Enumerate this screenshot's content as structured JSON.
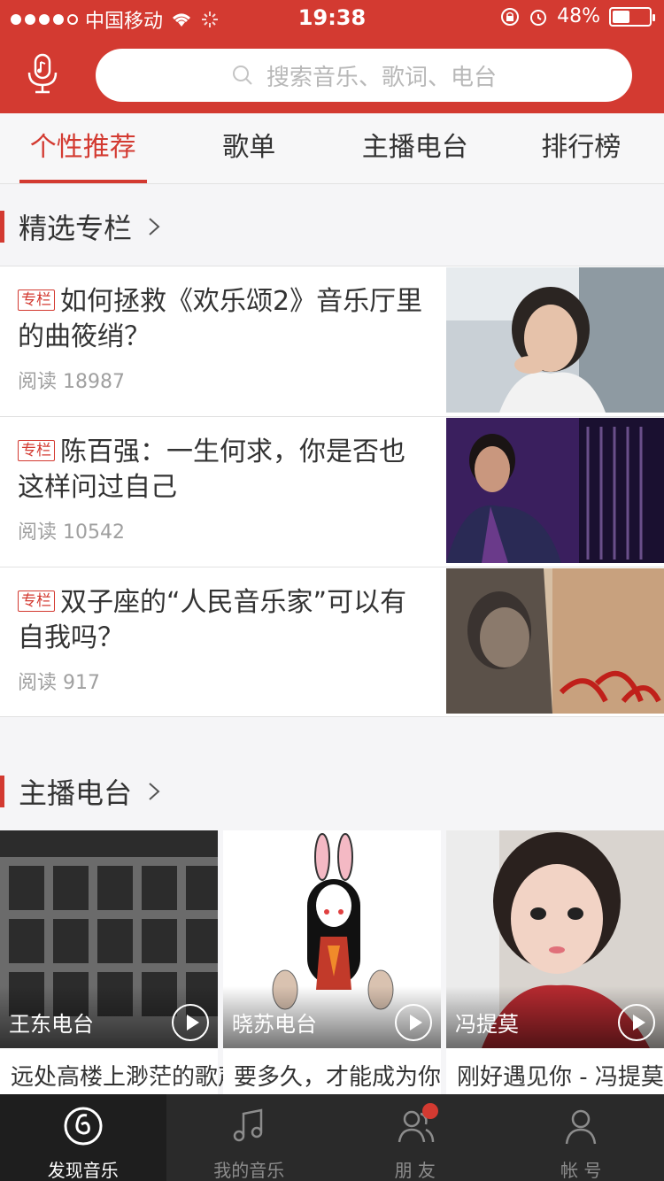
{
  "status": {
    "carrier": "中国移动",
    "time": "19:38",
    "battery": "48%",
    "battery_level": 0.48
  },
  "search": {
    "placeholder": "搜索音乐、歌词、电台"
  },
  "tabs": [
    "个性推荐",
    "歌单",
    "主播电台",
    "排行榜"
  ],
  "section1": {
    "title": "精选专栏"
  },
  "articles": [
    {
      "badge": "专栏",
      "title": "如何拯救《欢乐颂2》音乐厅里的曲筱绡？",
      "reads": "阅读 18987"
    },
    {
      "badge": "专栏",
      "title": "陈百强：一生何求，你是否也这样问过自己",
      "reads": "阅读 10542"
    },
    {
      "badge": "专栏",
      "title": "双子座的“人民音乐家”可以有自我吗？",
      "reads": "阅读 917"
    }
  ],
  "section2": {
    "title": "主播电台"
  },
  "cards": [
    {
      "channel": "王东电台",
      "title": "远处高楼上渺茫的歌声"
    },
    {
      "channel": "晓苏电台",
      "title": "要多久，才能成为你"
    },
    {
      "channel": "冯提莫",
      "title": "刚好遇见你 - 冯提莫"
    }
  ],
  "bottom": [
    "发现音乐",
    "我的音乐",
    "朋 友",
    "帐 号"
  ],
  "colors": {
    "brand": "#d33a31"
  }
}
